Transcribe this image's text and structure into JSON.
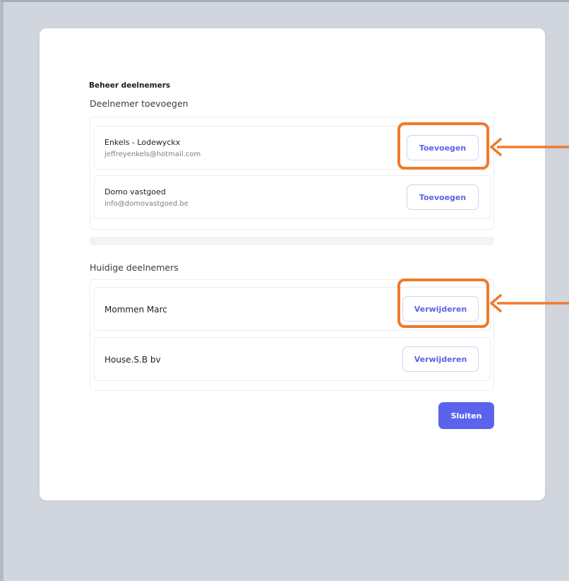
{
  "modal": {
    "title": "Beheer deelnemers",
    "add_section": {
      "title": "Deelnemer toevoegen",
      "items": [
        {
          "name": "Enkels - Lodewyckx",
          "email": "jeffreyenkels@hotmail.com",
          "button_label": "Toevoegen"
        },
        {
          "name": "Domo vastgoed",
          "email": "info@domovastgoed.be",
          "button_label": "Toevoegen"
        }
      ]
    },
    "current_section": {
      "title": "Huidige deelnemers",
      "items": [
        {
          "name": "Mommen Marc",
          "button_label": "Verwijderen"
        },
        {
          "name": "House.S.B bv",
          "button_label": "Verwijderen"
        }
      ]
    },
    "close_label": "Sluiten"
  },
  "colors": {
    "background": "#d1d5de",
    "accent": "#5b63ec",
    "annotation": "#f07a2a"
  },
  "annotations": [
    {
      "type": "highlight-with-arrow",
      "target": "toevoegen-button-1",
      "icon": "arrow-left-icon"
    },
    {
      "type": "highlight-with-arrow",
      "target": "verwijderen-button-1",
      "icon": "arrow-left-icon"
    }
  ]
}
